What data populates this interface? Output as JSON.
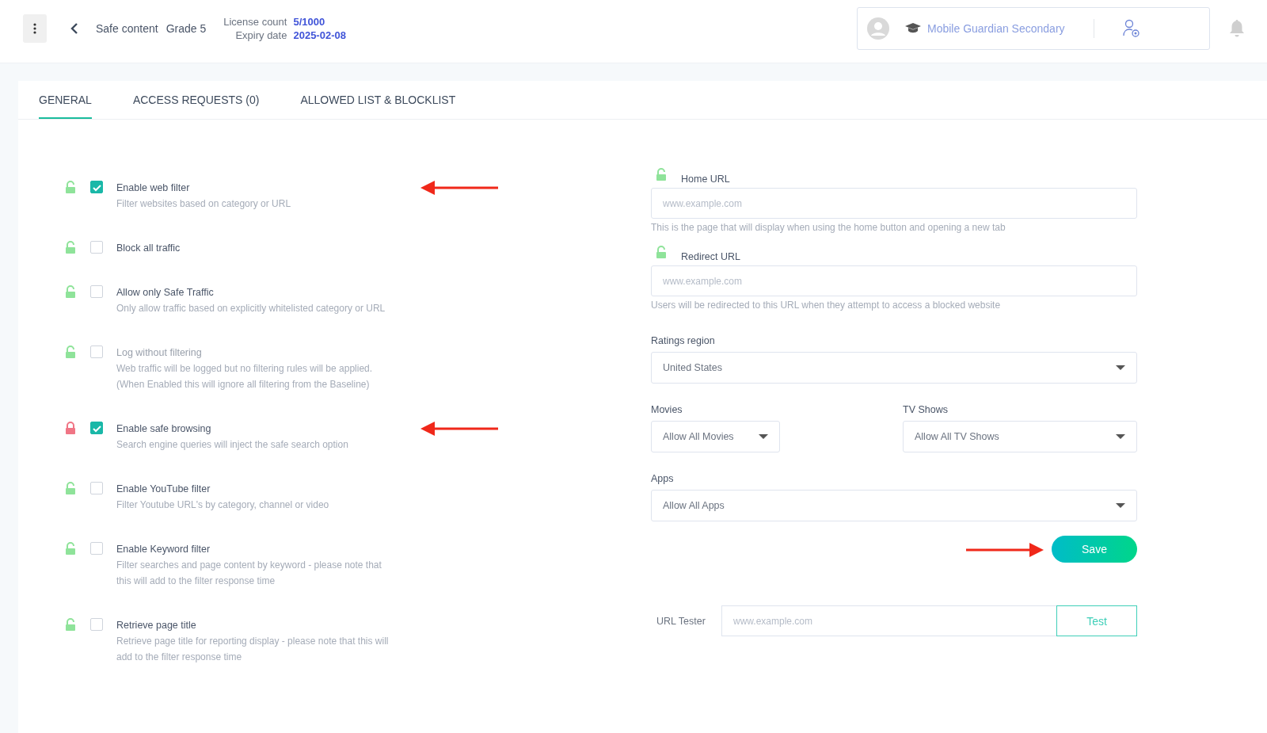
{
  "header": {
    "breadcrumb": [
      "Safe content",
      "Grade 5"
    ],
    "license": [
      {
        "label": "License count",
        "value": "5/1000"
      },
      {
        "label": "Expiry date",
        "value": "2025-02-08"
      }
    ],
    "school": "Mobile Guardian Secondary"
  },
  "tabs": [
    {
      "label": "GENERAL",
      "selected": true
    },
    {
      "label": "ACCESS REQUESTS (0)",
      "selected": false
    },
    {
      "label": "ALLOWED LIST & BLOCKLIST",
      "selected": false
    }
  ],
  "settings": [
    {
      "title": "Enable web filter",
      "description": "Filter websites based on category or URL",
      "checked": true,
      "locked": false,
      "disabled": false,
      "arrow": true
    },
    {
      "title": "Block all traffic",
      "checked": false,
      "locked": false,
      "disabled": false,
      "arrow": false
    },
    {
      "title": "Allow only Safe Traffic",
      "description": "Only allow traffic based on explicitly whitelisted category or URL",
      "checked": false,
      "locked": false,
      "disabled": false,
      "arrow": false
    },
    {
      "title": "Log without filtering",
      "description": "Web traffic will be logged but no filtering rules will be applied. (When Enabled this will ignore all filtering from the Baseline)",
      "checked": false,
      "locked": false,
      "disabled": true,
      "arrow": false
    },
    {
      "title": "Enable safe browsing",
      "description": "Search engine queries will inject the safe search option",
      "checked": true,
      "locked": true,
      "disabled": false,
      "arrow": true
    },
    {
      "title": "Enable YouTube filter",
      "description": "Filter Youtube URL's by category, channel or video",
      "checked": false,
      "locked": false,
      "disabled": false,
      "arrow": false
    },
    {
      "title": "Enable Keyword filter",
      "description": "Filter searches and page content by keyword - please note that this will add to the filter response time",
      "checked": false,
      "locked": false,
      "disabled": false,
      "arrow": false
    },
    {
      "title": "Retrieve page title",
      "description": "Retrieve page title for reporting display - please note that this will add to the filter response time",
      "checked": false,
      "locked": false,
      "disabled": false,
      "arrow": false
    }
  ],
  "url_fields": [
    {
      "label": "Home URL",
      "placeholder": "www.example.com",
      "help": "This is the page that will display when using the home button and opening a new tab",
      "locked": false
    },
    {
      "label": "Redirect URL",
      "placeholder": "www.example.com",
      "help": "Users will be redirected to this URL when they attempt to access a blocked website",
      "locked": false
    }
  ],
  "ratings_region": {
    "label": "Ratings region",
    "value": "United States"
  },
  "movies": {
    "label": "Movies",
    "value": "Allow All Movies"
  },
  "tv_shows": {
    "label": "TV Shows",
    "value": "Allow All TV Shows"
  },
  "apps": {
    "label": "Apps",
    "value": "Allow All Apps"
  },
  "save": {
    "label": "Save",
    "arrow": true
  },
  "url_tester": {
    "label": "URL Tester",
    "placeholder": "www.example.com",
    "button": "Test"
  }
}
